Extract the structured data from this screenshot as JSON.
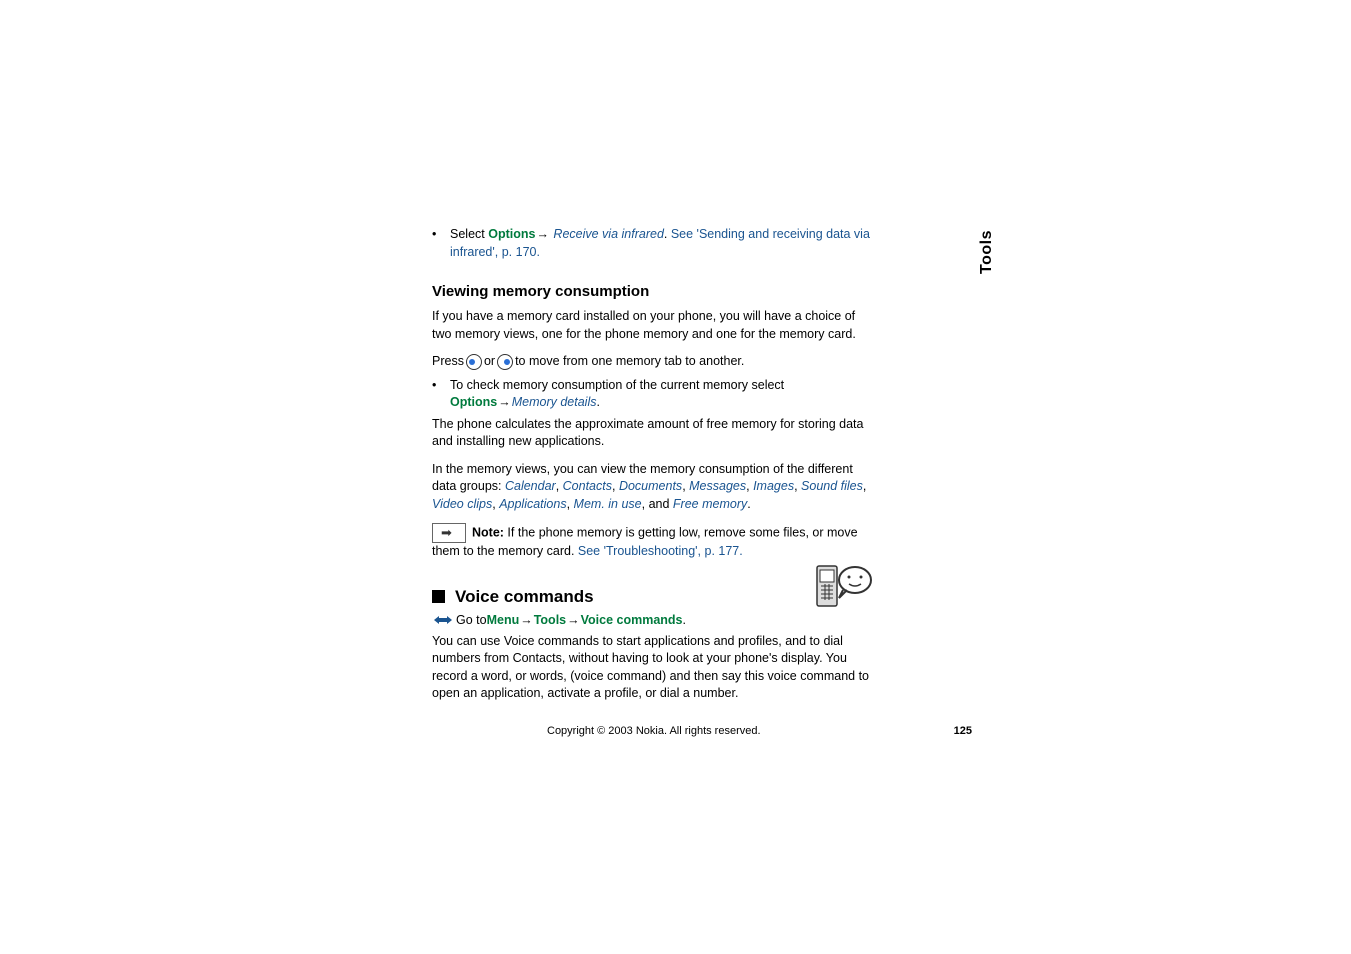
{
  "side_label": "Tools",
  "top_bullet": {
    "prefix": "Select ",
    "options": "Options",
    "arrow": "→",
    "receive": "Receive via infrared",
    "period": ". ",
    "see_link": "See 'Sending and receiving data via infrared', p. 170."
  },
  "heading_memory": "Viewing memory consumption",
  "mem_para1": "If you have a memory card installed on your phone, you will have a choice of two memory views, one for the phone memory and one for the memory card.",
  "press_line": {
    "prefix": "Press ",
    "mid": " or ",
    "suffix": " to move from one memory tab to another."
  },
  "mem_bullet": {
    "prefix": "To check memory consumption of the current memory select ",
    "options": "Options",
    "arrow": "→",
    "mem_details": "Memory details",
    "period": "."
  },
  "mem_para2": "The phone calculates the approximate amount of free memory for storing data and installing new applications.",
  "mem_para3": {
    "prefix": "In the memory views, you can view the memory consumption of the different data groups: ",
    "items": [
      "Calendar",
      "Contacts",
      "Documents",
      "Messages",
      "Images",
      "Sound files",
      "Video clips",
      "Applications",
      "Mem. in use"
    ],
    "and": ", and ",
    "last": "Free memory",
    "period": "."
  },
  "note": {
    "label": "Note:",
    "text": " If the phone memory is getting low, remove some files, or move them to the memory card. ",
    "link": "See 'Troubleshooting', p. 177."
  },
  "voice_heading": "Voice commands",
  "goto": {
    "prefix": " Go to ",
    "menu": "Menu",
    "arrow": "→",
    "tools": "Tools",
    "voice": "Voice commands",
    "period": "."
  },
  "voice_para": "You can use Voice commands to start applications and profiles, and to dial numbers from Contacts, without having to look at your phone's display. You record a word, or words, (voice command) and then say this voice command to open an application, activate a profile, or dial a number.",
  "footer": {
    "copyright": "Copyright © 2003 Nokia. All rights reserved.",
    "page": "125"
  }
}
